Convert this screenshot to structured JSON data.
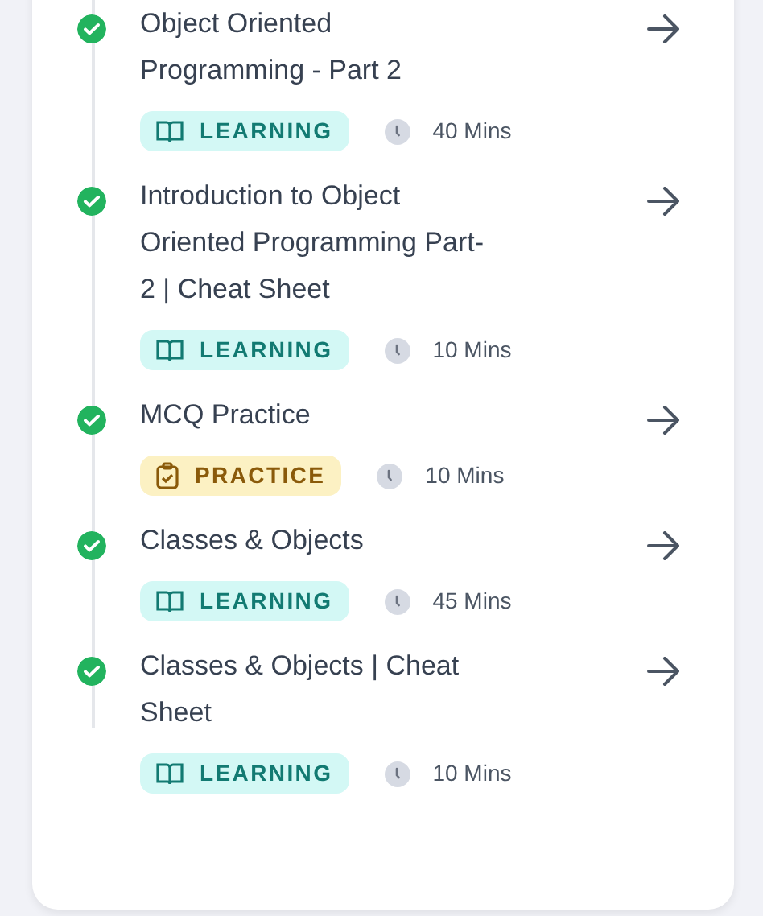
{
  "items": [
    {
      "title": "Object Oriented Programming - Part 2",
      "completed": true,
      "kind": "learning",
      "badge": "LEARNING",
      "duration": "40 Mins"
    },
    {
      "title": "Introduction to Object Oriented Programming Part-2 | Cheat Sheet",
      "completed": true,
      "kind": "learning",
      "badge": "LEARNING",
      "duration": "10 Mins"
    },
    {
      "title": "MCQ Practice",
      "completed": true,
      "kind": "practice",
      "badge": "PRACTICE",
      "duration": "10 Mins"
    },
    {
      "title": "Classes & Objects",
      "completed": true,
      "kind": "learning",
      "badge": "LEARNING",
      "duration": "45 Mins"
    },
    {
      "title": "Classes & Objects | Cheat Sheet",
      "completed": true,
      "kind": "learning",
      "badge": "LEARNING",
      "duration": "10 Mins"
    }
  ]
}
